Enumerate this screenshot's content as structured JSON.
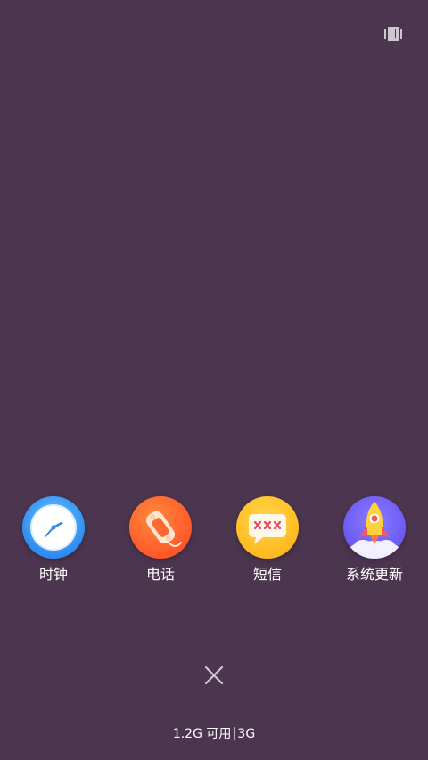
{
  "top_right": {
    "icon": "recents-view-icon"
  },
  "apps": [
    {
      "label": "时钟",
      "icon": "clock-icon"
    },
    {
      "label": "电话",
      "icon": "phone-icon"
    },
    {
      "label": "短信",
      "icon": "message-icon"
    },
    {
      "label": "系统更新",
      "icon": "rocket-icon"
    }
  ],
  "close": {
    "icon": "close-icon"
  },
  "memory": {
    "available": "1.2G 可用",
    "total": "3G"
  },
  "colors": {
    "background": "#4c354f"
  }
}
